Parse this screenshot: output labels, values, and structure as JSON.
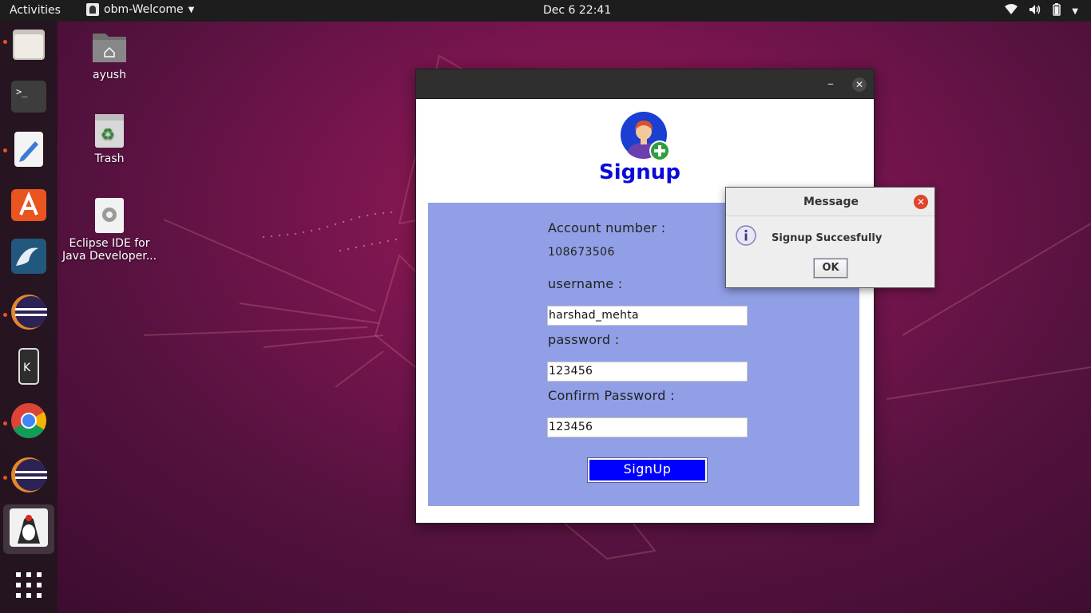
{
  "topbar": {
    "activities": "Activities",
    "app_name": "obm-Welcome",
    "clock": "Dec 6  22:41"
  },
  "dock": {
    "items": [
      "files-icon",
      "terminal-icon",
      "text-editor-icon",
      "software-center-icon",
      "mysql-workbench-icon",
      "eclipse-icon",
      "kde-connect-icon",
      "chrome-icon",
      "eclipse-icon-2",
      "java-app-icon",
      "show-apps-icon"
    ]
  },
  "desktop": {
    "home_label": "ayush",
    "trash_label": "Trash",
    "eclipse_label_line1": "Eclipse IDE for",
    "eclipse_label_line2": "Java Developer..."
  },
  "signup_window": {
    "heading": "Signup",
    "account_number_label": "Account number :",
    "account_number_value": "108673506",
    "username_label": "username :",
    "username_value": "harshad_mehta",
    "password_label": "password :",
    "password_value": "123456",
    "confirm_password_label": "Confirm Password :",
    "confirm_password_value": "123456",
    "signup_button": "SignUp",
    "minimize_symbol": "–",
    "close_symbol": "✕"
  },
  "message_dialog": {
    "title": "Message",
    "message": "Signup Succesfully",
    "ok_button": "OK",
    "close_symbol": "✕"
  },
  "colors": {
    "panel_bg": "#919fe6",
    "heading_color": "#0a0adb",
    "signup_button_bg": "#0000ff",
    "dock_dot": "#e95420"
  }
}
